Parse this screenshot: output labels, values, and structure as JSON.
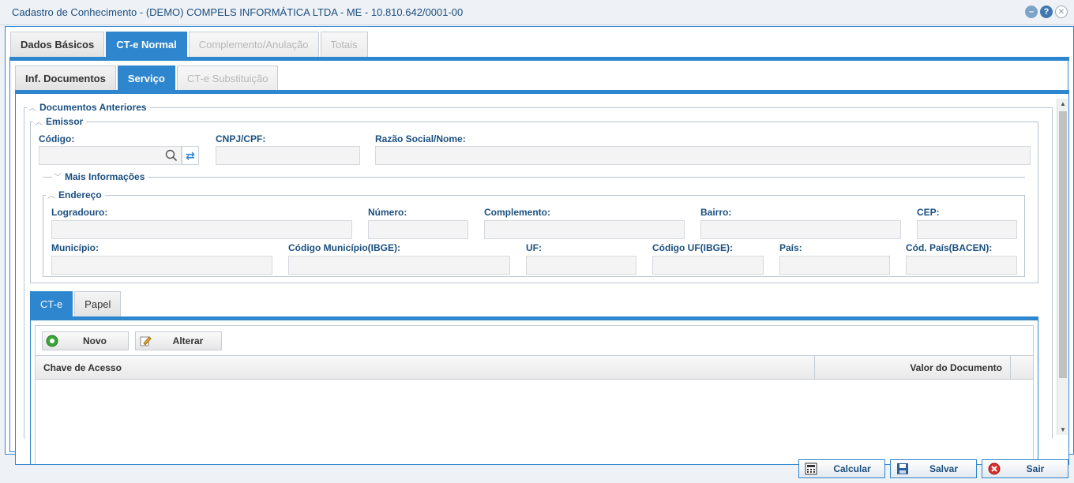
{
  "window": {
    "title": "Cadastro de Conhecimento - (DEMO) COMPELS INFORMÁTICA LTDA - ME - 10.810.642/0001-00"
  },
  "main_tabs": [
    {
      "label": "Dados Básicos",
      "state": "normal"
    },
    {
      "label": "CT-e Normal",
      "state": "active"
    },
    {
      "label": "Complemento/Anulação",
      "state": "disabled"
    },
    {
      "label": "Totais",
      "state": "disabled"
    }
  ],
  "sub_tabs": [
    {
      "label": "Inf. Documentos",
      "state": "normal"
    },
    {
      "label": "Serviço",
      "state": "active"
    },
    {
      "label": "CT-e Substituição",
      "state": "disabled"
    }
  ],
  "documentos_anteriores": {
    "legend": "Documentos Anteriores",
    "emissor": {
      "legend": "Emissor",
      "codigo_label": "Código:",
      "codigo_value": "",
      "cnpj_label": "CNPJ/CPF:",
      "cnpj_value": "",
      "razao_label": "Razão Social/Nome:",
      "razao_value": "",
      "mais_informacoes": "Mais Informações",
      "endereco": {
        "legend": "Endereço",
        "logradouro_label": "Logradouro:",
        "numero_label": "Número:",
        "complemento_label": "Complemento:",
        "bairro_label": "Bairro:",
        "cep_label": "CEP:",
        "municipio_label": "Município:",
        "codigo_municipio_label": "Código Município(IBGE):",
        "uf_label": "UF:",
        "codigo_uf_label": "Código UF(IBGE):",
        "pais_label": "País:",
        "codigo_pais_label": "Cód. País(BACEN):"
      }
    }
  },
  "doc_tabs": [
    {
      "label": "CT-e",
      "state": "active"
    },
    {
      "label": "Papel",
      "state": "normal"
    }
  ],
  "grid_toolbar": {
    "novo_label": "Novo",
    "alterar_label": "Alterar"
  },
  "grid": {
    "columns": [
      "Chave de Acesso",
      "Valor do Documento"
    ],
    "rows": []
  },
  "footer": {
    "calcular_label": "Calcular",
    "salvar_label": "Salvar",
    "sair_label": "Sair"
  },
  "colors": {
    "accent": "#2e86cf",
    "label": "#1a4f80",
    "input_bg": "#f4f4f4"
  }
}
